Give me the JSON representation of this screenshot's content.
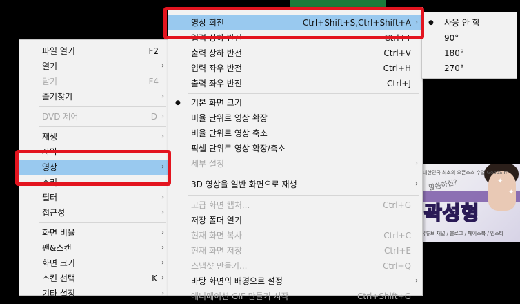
{
  "main_menu": {
    "items": [
      {
        "label": "파일 열기",
        "shortcut": "F2"
      },
      {
        "label": "열기",
        "arrow": "›"
      },
      {
        "label": "닫기",
        "shortcut": "F4",
        "disabled": true
      },
      {
        "label": "즐겨찾기",
        "arrow": "›"
      },
      {
        "label": "DVD 제어",
        "shortcut": "D",
        "arrow": "›",
        "disabled": true
      },
      {
        "label": "재생",
        "arrow": "›"
      },
      {
        "label": "자막"
      },
      {
        "label": "영상",
        "arrow": "›",
        "highlighted": true
      },
      {
        "label": "소리"
      },
      {
        "label": "필터",
        "arrow": "›"
      },
      {
        "label": "접근성",
        "arrow": "›"
      },
      {
        "label": "화면 비율",
        "arrow": "›"
      },
      {
        "label": "팬&스캔",
        "arrow": "›"
      },
      {
        "label": "화면 크기",
        "arrow": "›"
      },
      {
        "label": "스킨 선택",
        "shortcut": "K",
        "arrow": "›"
      },
      {
        "label": "기타 설정",
        "arrow": "›"
      }
    ]
  },
  "video_submenu": {
    "items": [
      {
        "label": "영상 회전",
        "shortcut": "Ctrl+Shift+S,Ctrl+Shift+A",
        "arrow": "›",
        "highlighted": true
      },
      {
        "label": "입력 상하 반전",
        "shortcut": "Ctrl+T"
      },
      {
        "label": "출력 상하 반전",
        "shortcut": "Ctrl+V"
      },
      {
        "label": "입력 좌우 반전",
        "shortcut": "Ctrl+H"
      },
      {
        "label": "출력 좌우 반전",
        "shortcut": "Ctrl+J"
      },
      {
        "label": "기본 화면 크기",
        "checked": true
      },
      {
        "label": "비율 단위로 영상 확장"
      },
      {
        "label": "비율 단위로 영상 축소"
      },
      {
        "label": "픽셀 단위로 영상 확장/축소"
      },
      {
        "label": "세부 설정",
        "arrow": "›",
        "disabled": true
      },
      {
        "label": "3D 영상을 일반 화면으로 재생",
        "arrow": "›"
      },
      {
        "label": "고급 화면 캡처...",
        "shortcut": "Ctrl+G",
        "disabled": true
      },
      {
        "label": "저장 폴더 열기"
      },
      {
        "label": "현재 화면 복사",
        "shortcut": "Ctrl+C",
        "disabled": true
      },
      {
        "label": "현재 화면 저장",
        "shortcut": "Ctrl+E",
        "disabled": true
      },
      {
        "label": "스냅샷 만들기...",
        "shortcut": "Ctrl+Q",
        "disabled": true
      },
      {
        "label": "바탕 화면의 배경으로 설정",
        "arrow": "›"
      },
      {
        "label": "애니메이션 GIF 만들기 시작",
        "shortcut": "Ctrl+Shift+G",
        "disabled": true
      }
    ]
  },
  "rotation_submenu": {
    "items": [
      {
        "label": "사용 안 함",
        "checked": true
      },
      {
        "label": "90°"
      },
      {
        "label": "180°"
      },
      {
        "label": "270°"
      }
    ]
  },
  "background_video": {
    "header": "대한민국 최초의 오픈소스 수업 GoodSim",
    "kicker": "말씀하신?",
    "title": "곽성형",
    "footer": "유튜브 채널 / 블로그 / 페이스북 / 인스타"
  },
  "bullet_glyph": "●",
  "colors": {
    "highlight": "#99c9ef",
    "callout_red": "#e3141f",
    "menu_bg": "#f2f2f2",
    "disabled_text": "#a9a9a9"
  }
}
